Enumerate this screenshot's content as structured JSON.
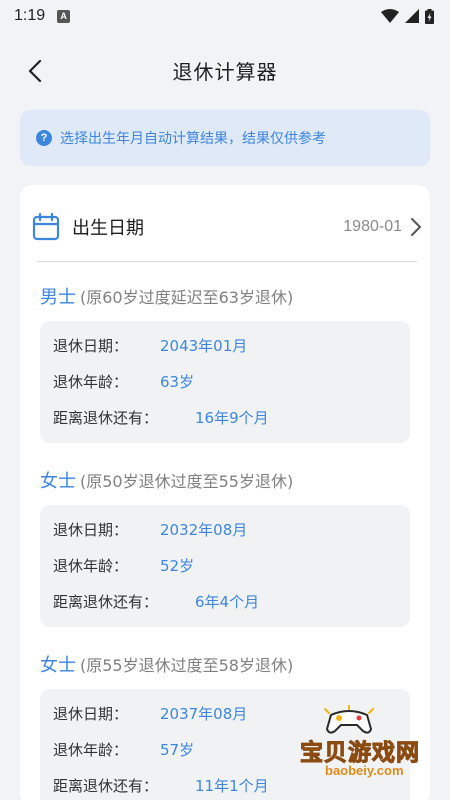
{
  "status_bar": {
    "time": "1:19",
    "badge": "A"
  },
  "header": {
    "title": "退休计算器"
  },
  "notice": {
    "icon": "question-circle-icon",
    "text": "选择出生年月自动计算结果，结果仅供参考"
  },
  "birth": {
    "label": "出生日期",
    "value": "1980-01",
    "icon": "calendar-icon"
  },
  "sections": [
    {
      "gender": "男士",
      "note": "(原60岁过度延迟至63岁退休)",
      "rows": [
        {
          "label": "退休日期：",
          "value": "2043年01月"
        },
        {
          "label": "退休年龄：",
          "value": "63岁"
        },
        {
          "label": "距离退休还有：",
          "value": "16年9个月"
        }
      ]
    },
    {
      "gender": "女士",
      "note": "(原50岁退休过度至55岁退休)",
      "rows": [
        {
          "label": "退休日期：",
          "value": "2032年08月"
        },
        {
          "label": "退休年龄：",
          "value": "52岁"
        },
        {
          "label": "距离退休还有：",
          "value": "6年4个月"
        }
      ]
    },
    {
      "gender": "女士",
      "note": "(原55岁退休过度至58岁退休)",
      "rows": [
        {
          "label": "退休日期：",
          "value": "2037年08月"
        },
        {
          "label": "退休年龄：",
          "value": "57岁"
        },
        {
          "label": "距离退休还有：",
          "value": "11年1个月"
        }
      ]
    }
  ],
  "watermark": {
    "main": "宝贝游戏网",
    "sub": "baobeiy.com"
  },
  "colors": {
    "accent": "#3d86e0",
    "notice_bg": "#dfe9f7",
    "page_bg": "#f2f3f6",
    "box_bg": "#f1f2f4"
  }
}
